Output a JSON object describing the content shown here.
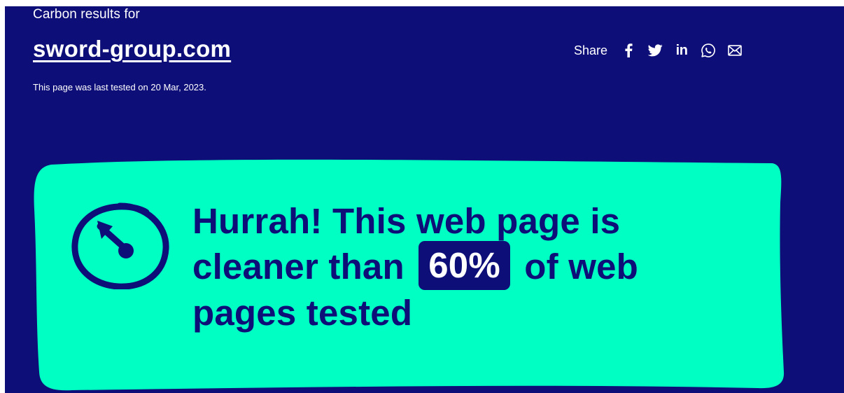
{
  "header": {
    "pre_title": "Carbon results for",
    "site": "sword-group.com",
    "last_tested": "This page was last tested on 20 Mar, 2023."
  },
  "share": {
    "label": "Share",
    "icons": [
      "facebook-icon",
      "twitter-icon",
      "linkedin-icon",
      "whatsapp-icon",
      "email-icon"
    ],
    "linkedin_glyph": "in"
  },
  "result": {
    "line1": "Hurrah! This web page is",
    "line2_before": "cleaner than",
    "percent": "60%",
    "line2_after": "of web",
    "line3": "pages tested"
  },
  "colors": {
    "background": "#0d0e78",
    "accent": "#00ffc2",
    "text_on_dark": "#ffffff",
    "text_on_accent": "#0d0e78"
  }
}
